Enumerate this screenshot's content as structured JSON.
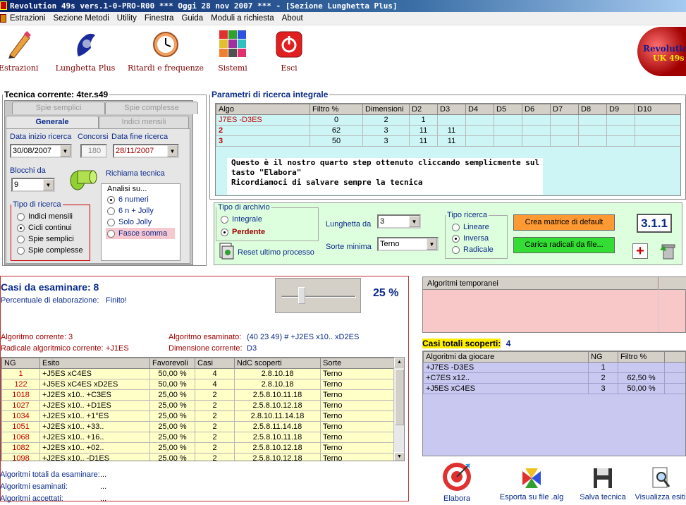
{
  "app": {
    "title": "Revolution 49s vers.1-0-PRO-R00  ***  Oggi 28 nov 2007  ***   - [Sezione Lunghetta Plus]"
  },
  "menu": [
    "Estrazioni",
    "Sezione Metodi",
    "Utility",
    "Finestra",
    "Guida",
    "Moduli a richiesta",
    "About"
  ],
  "toolbar": {
    "estrazioni": "Estrazioni",
    "lunghetta": "Lunghetta Plus",
    "ritardi": "Ritardi e frequenze",
    "sistemi": "Sistemi",
    "esci": "Esci",
    "logo_line1": "Revolution",
    "logo_line2": "UK 49s"
  },
  "tecnica": {
    "title": "Tecnica corrente: 4ter.s49",
    "tab_spie_semplici": "Spie semplici",
    "tab_spie_complesse": "Spie complesse",
    "tab_generale": "Generale",
    "tab_indici": "Indici mensili",
    "data_inizio_label": "Data inizio ricerca",
    "data_inizio": "30/08/2007",
    "concorsi_label": "Concorsi",
    "concorsi": "180",
    "data_fine_label": "Data fine ricerca",
    "data_fine": "28/11/2007",
    "blocchi_label": "Blocchi da",
    "blocchi": "9",
    "richiama": "Richiama tecnica",
    "tipo_ricerca_label": "Tipo di ricerca",
    "tipo_ricerca": [
      "Indici mensili",
      "Cicli continui",
      "Spie semplici",
      "Spie complesse"
    ],
    "analisi_label": "Analisi su...",
    "analisi": [
      "6 numeri",
      "6 n + Jolly",
      "Solo Jolly",
      "Fasce somma"
    ]
  },
  "parametri": {
    "title": "Parametri di ricerca integrale",
    "headers": [
      "Algo",
      "Filtro %",
      "Dimensioni",
      "D2",
      "D3",
      "D4",
      "D5",
      "D6",
      "D7",
      "D8",
      "D9",
      "D10"
    ],
    "rows": [
      [
        "J7ES -D3ES",
        "0",
        "2",
        "1",
        "",
        "",
        "",
        "",
        "",
        "",
        "",
        ""
      ],
      [
        "2",
        "62",
        "3",
        "11",
        "11",
        "",
        "",
        "",
        "",
        "",
        "",
        ""
      ],
      [
        "3",
        "50",
        "3",
        "11",
        "11",
        "",
        "",
        "",
        "",
        "",
        "",
        ""
      ]
    ],
    "note_line1": "Questo è il nostro quarto step ottenuto cliccando semplicmente sul",
    "note_line2": "tasto \"Elabora\"",
    "note_line3": "Ricordiamoci di salvare sempre la tecnica"
  },
  "archivio": {
    "tipo_label": "Tipo di archivio",
    "tipi": [
      "Integrale",
      "Perdente"
    ],
    "reset": "Reset ultimo processo",
    "lunghetta_label": "Lunghetta da",
    "lunghetta": "3",
    "sorte_label": "Sorte minima",
    "sorte": "Terno",
    "tipo_ricerca_label": "Tipo ricerca",
    "tipo_ricerca": [
      "Lineare",
      "Inversa",
      "Radicale"
    ],
    "crea": "Crea matrice di default",
    "carica": "Carica radicali da file...",
    "version": "3.1.1",
    "add_icon": "plus-icon",
    "trash_icon": "trash-icon"
  },
  "casi": {
    "title": "Casi da esaminare: 8",
    "perc_label": "Percentuale di elaborazione:",
    "perc_value": "Finito!",
    "percent": "25 %",
    "slider_level": 0.25,
    "algo_corrente": "Algoritmo corrente: 3",
    "algo_esaminato_label": "Algoritmo esaminato:",
    "algo_esaminato": "(40 23 49) # +J2ES x10.. xD2ES",
    "radicale_label": "Radicale algoritmico corrente:",
    "radicale": "+J1ES",
    "dimensione_label": "Dimensione corrente:",
    "dimensione": "D3",
    "headers": [
      "NG",
      "Esito",
      "Favorevoli",
      "Casi",
      "NdC scoperti",
      "Sorte"
    ],
    "rows": [
      [
        "1",
        "+J5ES xC4ES",
        "50,00 %",
        "4",
        "2.8.10.18",
        "Terno"
      ],
      [
        "122",
        "+J5ES xC4ES xD2ES",
        "50,00 %",
        "4",
        "2.8.10.18",
        "Terno"
      ],
      [
        "1018",
        "+J2ES x10.. +C3ES",
        "25,00 %",
        "2",
        "2.5.8.10.11.18",
        "Terno"
      ],
      [
        "1027",
        "+J2ES x10.. +D1ES",
        "25,00 %",
        "2",
        "2.5.8.10.12.18",
        "Terno"
      ],
      [
        "1034",
        "+J2ES x10.. +1°ES",
        "25,00 %",
        "2",
        "2.8.10.11.14.18",
        "Terno"
      ],
      [
        "1051",
        "+J2ES x10.. +33..",
        "25,00 %",
        "2",
        "2.5.8.11.14.18",
        "Terno"
      ],
      [
        "1068",
        "+J2ES x10.. +16..",
        "25,00 %",
        "2",
        "2.5.8.10.11.18",
        "Terno"
      ],
      [
        "1082",
        "+J2ES x10.. +02..",
        "25,00 %",
        "2",
        "2.5.8.10.12.18",
        "Terno"
      ],
      [
        "1098",
        "+J2ES x10.. -D1ES",
        "25,00 %",
        "2",
        "2.5.8.10.12.18",
        "Terno"
      ]
    ],
    "tot_label": "Algoritmi totali da esaminare:",
    "tot": "...",
    "esaminati_label": "Algoritmi esaminati:",
    "esaminati": "...",
    "accettati_label": "Algoritmi accettati:",
    "accettati": "..."
  },
  "temporanei": {
    "header": "Algoritmi temporanei"
  },
  "scoperti": {
    "label": "Casi totali scoperti:",
    "value": "4",
    "headers": [
      "Algoritmi da giocare",
      "NG",
      "Filtro %"
    ],
    "rows": [
      [
        "+J7ES -D3ES",
        "1",
        ""
      ],
      [
        "+C7ES x12..",
        "2",
        "62,50 %"
      ],
      [
        "+J5ES xC4ES",
        "3",
        "50,00 %"
      ]
    ]
  },
  "actions": {
    "elabora": "Elabora",
    "esporta": "Esporta su file .alg",
    "salva": "Salva tecnica",
    "visualizza": "Visualizza esiti"
  },
  "colors": {
    "title_blue": "#0a246a",
    "label_blue": "#0a2a8a",
    "yellow_grid": "#ffffc8",
    "cyan_grid": "#cdf5f5",
    "pink_panel": "#f8c8c8",
    "lavender_panel": "#c8c8f0",
    "orange_btn": "#ff9933",
    "green_btn": "#33dd33"
  }
}
